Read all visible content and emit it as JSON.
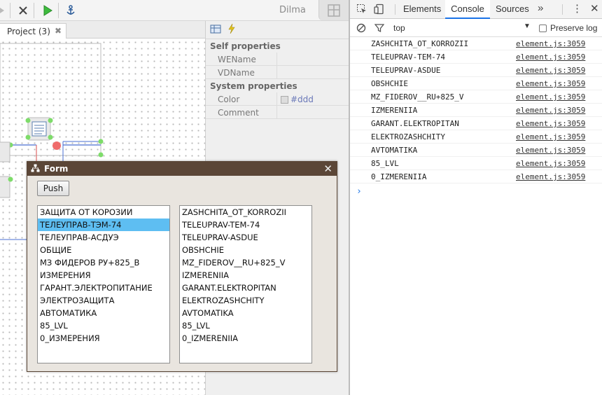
{
  "app": {
    "brand": "Dilma",
    "tab_label": "Project (3)",
    "tab_close": "✖"
  },
  "properties": {
    "self_header": "Self properties",
    "system_header": "System properties",
    "rows_self": [
      {
        "key": "WEName",
        "value": ""
      },
      {
        "key": "VDName",
        "value": ""
      }
    ],
    "rows_system": [
      {
        "key": "Color",
        "value": "#ddd"
      },
      {
        "key": "Comment",
        "value": ""
      }
    ]
  },
  "form": {
    "title": "Form",
    "close": "✕",
    "push_label": "Push",
    "left_items": [
      "ЗАЩИТА ОТ КОРОЗИИ",
      "ТЕЛЕУПРАВ-ТЭМ-74",
      "ТЕЛЕУПРАВ-АСДУЭ",
      "ОБЩИЕ",
      "МЗ ФИДЕРОВ РУ+825_В",
      "ИЗМЕРЕНИЯ",
      "ГАРАНТ.ЭЛЕКТРОПИТАНИЕ",
      "ЭЛЕКТРОЗАЩИТА",
      "АВТОМАТИКА",
      "85_LVL",
      "0_ИЗМЕРЕНИЯ"
    ],
    "selected_index": 1,
    "right_items": [
      "ZASHCHITA_OT_KORROZII",
      "TELEUPRAV-TEM-74",
      "TELEUPRAV-ASDUE",
      "OBSHCHIE",
      "MZ_FIDEROV__RU+825_V",
      "IZMERENIIA",
      "GARANT.ELEKTROPITAN",
      "ELEKTROZASHCHITY",
      "AVTOMATIKA",
      "85_LVL",
      "0_IZMERENIIA"
    ]
  },
  "devtools": {
    "tabs": [
      "Elements",
      "Console",
      "Sources"
    ],
    "active_tab": "Console",
    "more": "»",
    "kebab": "⋮",
    "close": "✕",
    "context": "top",
    "context_caret": "▼",
    "preserve_log": "Preserve log",
    "prompt": "›",
    "logs": [
      {
        "msg": "ZASHCHITA_OT_KORROZII",
        "src": "element.js:3059"
      },
      {
        "msg": "TELEUPRAV-TEM-74",
        "src": "element.js:3059"
      },
      {
        "msg": "TELEUPRAV-ASDUE",
        "src": "element.js:3059"
      },
      {
        "msg": "OBSHCHIE",
        "src": "element.js:3059"
      },
      {
        "msg": "MZ_FIDEROV__RU+825_V",
        "src": "element.js:3059"
      },
      {
        "msg": "IZMERENIIA",
        "src": "element.js:3059"
      },
      {
        "msg": "GARANT.ELEKTROPITAN",
        "src": "element.js:3059"
      },
      {
        "msg": "ELEKTROZASHCHITY",
        "src": "element.js:3059"
      },
      {
        "msg": "AVTOMATIKA",
        "src": "element.js:3059"
      },
      {
        "msg": "85_LVL",
        "src": "element.js:3059"
      },
      {
        "msg": "0_IZMERENIIA",
        "src": "element.js:3059"
      }
    ]
  },
  "colors": {
    "form_title_bg": "#5b4637",
    "selection": "#5ebef2",
    "devtools_accent": "#1a73e8"
  }
}
